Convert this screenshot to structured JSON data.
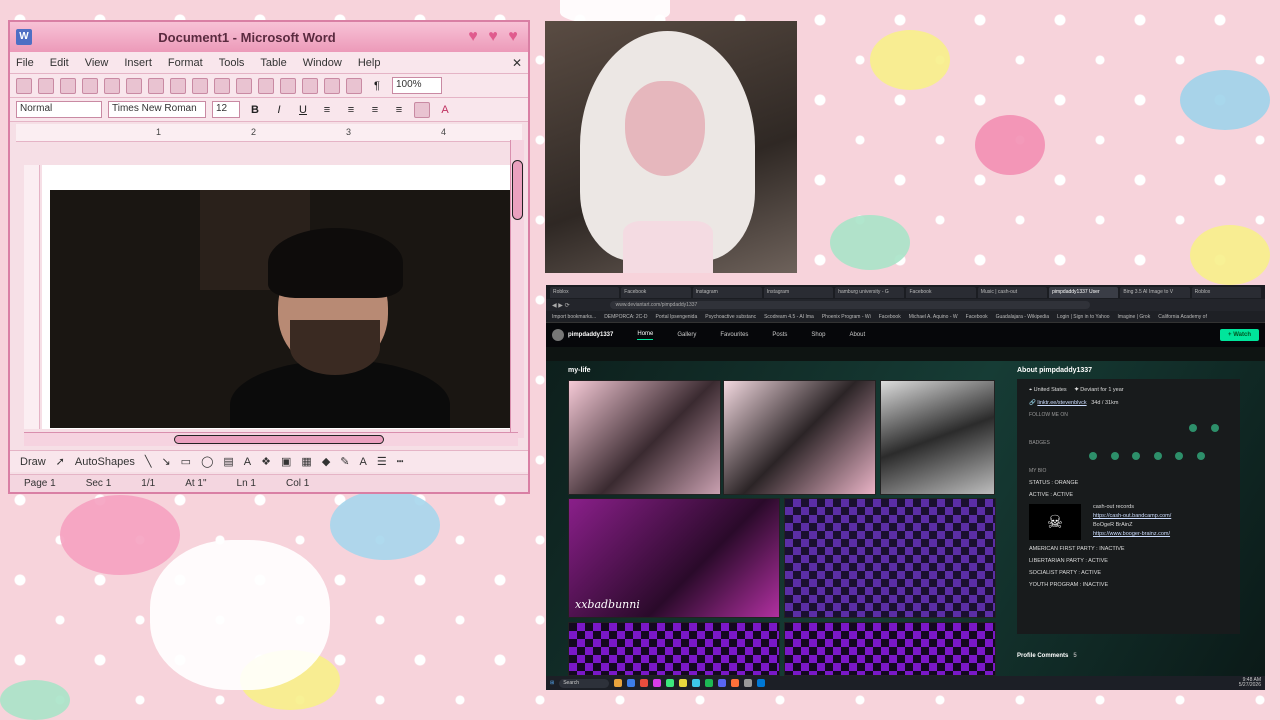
{
  "word": {
    "title": "Document1 - Microsoft Word",
    "menu": [
      "File",
      "Edit",
      "View",
      "Insert",
      "Format",
      "Tools",
      "Table",
      "Window",
      "Help"
    ],
    "zoom": "100%",
    "style": "Normal",
    "font": "Times New Roman",
    "font_size": "12",
    "bold": "B",
    "italic": "I",
    "underline": "U",
    "ruler_marks": [
      "1",
      "2",
      "3",
      "4"
    ],
    "draw_label": "Draw",
    "autoshapes_label": "AutoShapes",
    "status": {
      "page": "Page 1",
      "sec": "Sec 1",
      "of": "1/1",
      "at": "At 1\"",
      "ln": "Ln 1",
      "col": "Col 1"
    }
  },
  "browser": {
    "tabs": [
      "Roblox",
      "Facebook",
      "Instagram",
      "Instagram",
      "hamburg university - G",
      "Facebook",
      "Music | cash-out",
      "pimpdaddy1337 User",
      "Bing 3.5 AI Image to V",
      "Roblox"
    ],
    "url": "www.deviantart.com/pimpdaddy1337",
    "bookmarks": [
      "Import bookmarks...",
      "DEMPORCA: 2C-D",
      "Portal Ipsengenida",
      "Psychoactive substanc",
      "Scodream 4.5 - AI Ima",
      "Phoenix Program - Wi",
      "Facebook",
      "Michael A. Aquino - W",
      "Facebook",
      "Guadalajara - Wikipedia",
      "Login | Sign in to Yahoo",
      "Imagine | Grok",
      "California Academy of"
    ],
    "da": {
      "username": "pimpdaddy1337",
      "nav": [
        "Home",
        "Gallery",
        "Favourites",
        "Posts",
        "Shop",
        "About"
      ],
      "watch_label": "+ Watch",
      "section_title": "my-life",
      "gallery_caption": "xxbadbunni",
      "about": {
        "title": "About pimpdaddy1337",
        "location": "United States",
        "member": "Deviant for 1 year",
        "link": "linktr.ee/stevenblvck",
        "stats": "34d / 31km",
        "follow_label": "FOLLOW ME ON",
        "badges_label": "BADGES",
        "bio_label": "MY BIO",
        "status": "STATUS : ORANGE",
        "active": "ACTIVE : ACTIVE",
        "records": "cash-out records",
        "link1": "https://cash-out.bandcamp.com/",
        "bands": "BoOgeR BrAinZ",
        "link2": "https://www.booger-brainz.com/",
        "party1": "AMERICAN FIRST PARTY : INACTIVE",
        "party2": "LIBERTARIAN PARTY : ACTIVE",
        "party3": "SOCIALIST PARTY : ACTIVE",
        "party4": "YOUTH PROGRAM : INACTIVE"
      },
      "comments_label": "Profile Comments",
      "comments_count": "5"
    },
    "taskbar": {
      "search": "Search",
      "time": "9:48 AM",
      "date": "5/27/2026"
    }
  },
  "colors": {
    "wallpaper": "#f7d3db",
    "word_chrome": "#ec9ab9",
    "da_accent": "#00e59b"
  }
}
